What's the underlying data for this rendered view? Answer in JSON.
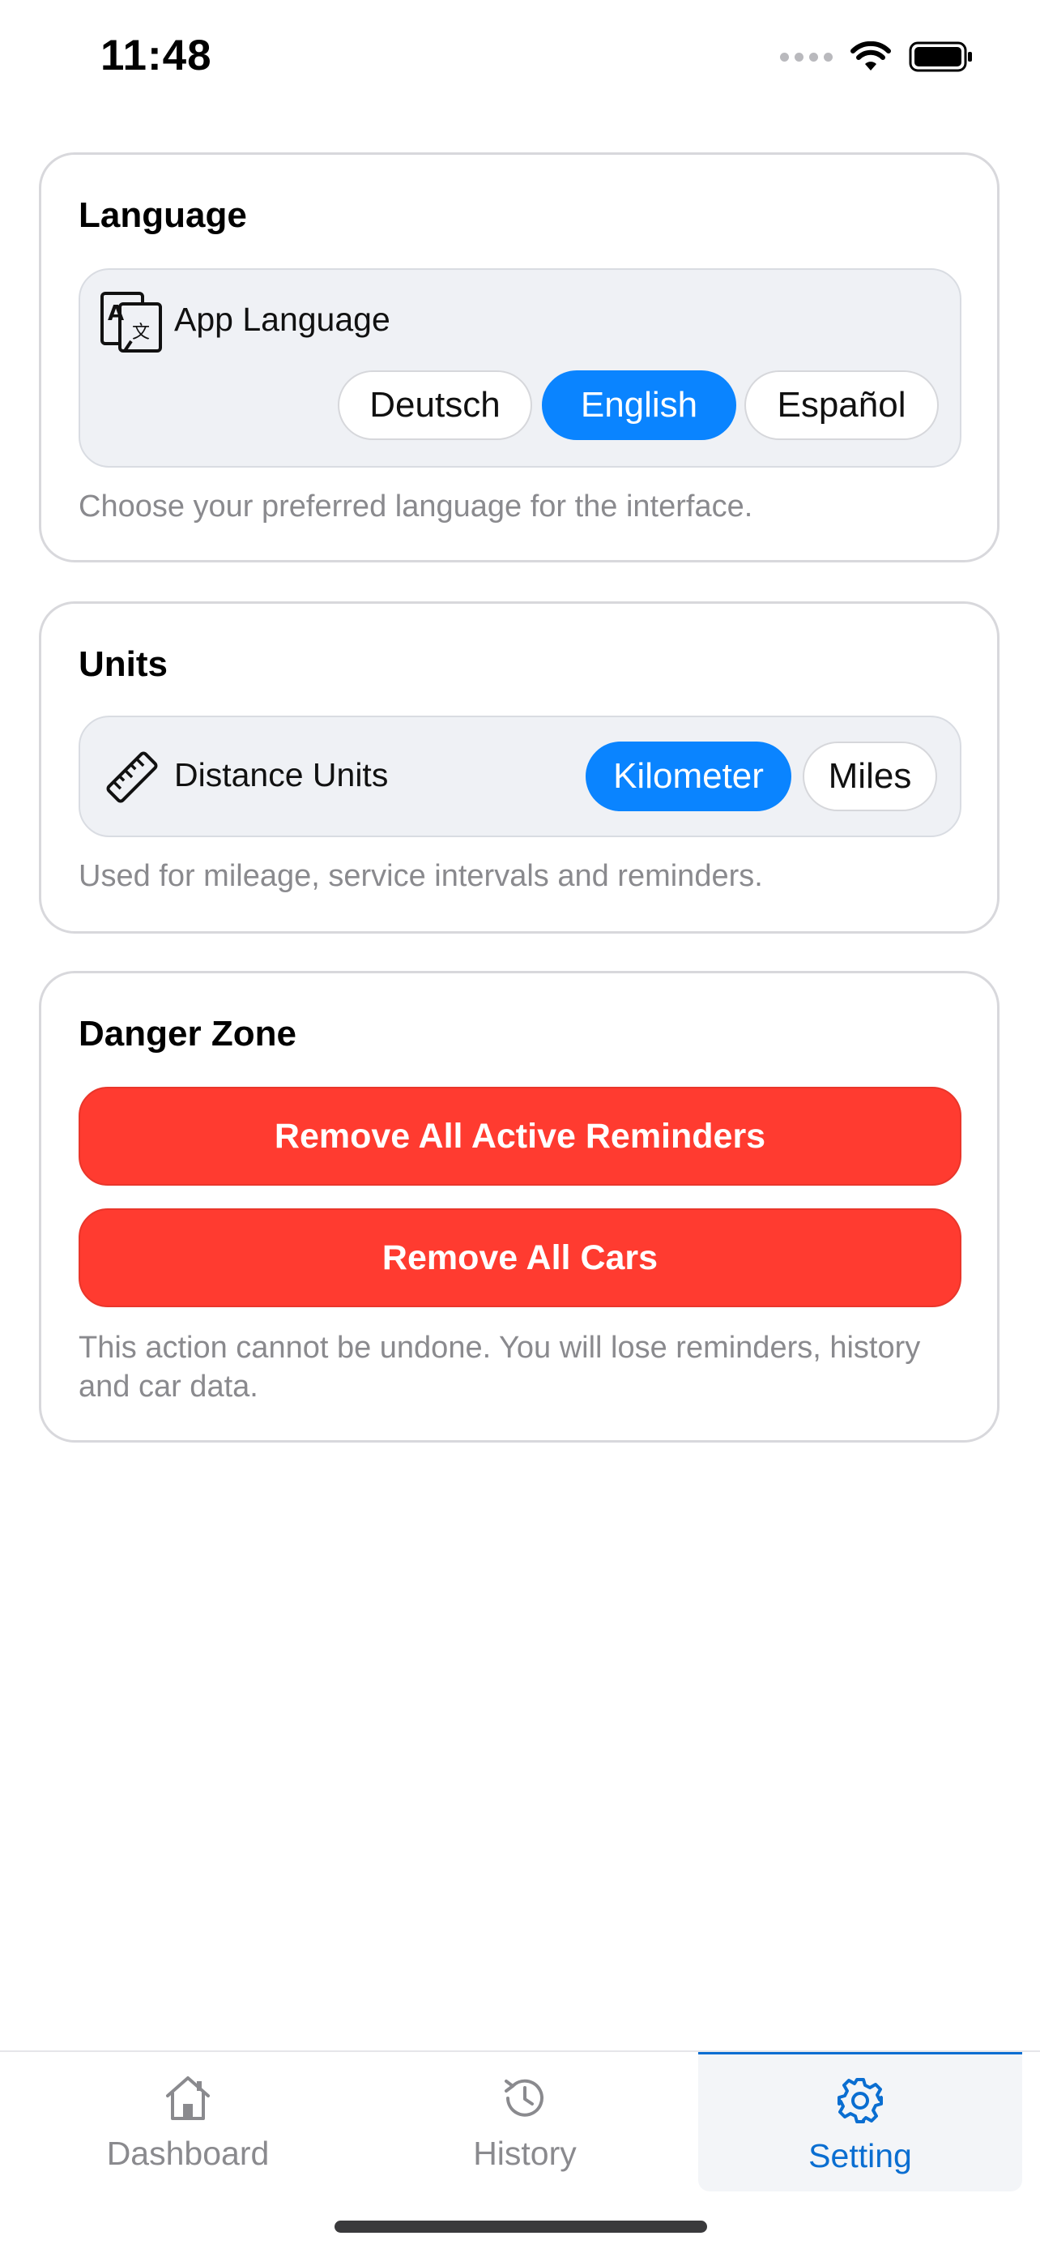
{
  "status_bar": {
    "time": "11:48"
  },
  "language_section": {
    "title": "Language",
    "row_label": "App Language",
    "row_icon": "translate-icon",
    "options": [
      "Deutsch",
      "English",
      "Español"
    ],
    "selected": "English",
    "helper": "Choose your preferred language for the interface."
  },
  "units_section": {
    "title": "Units",
    "row_label": "Distance Units",
    "row_icon": "ruler-icon",
    "options": [
      "Kilometer",
      "Miles"
    ],
    "selected": "Kilometer",
    "helper": "Used for mileage, service intervals and reminders."
  },
  "danger_section": {
    "title": "Danger Zone",
    "remove_reminders_label": "Remove All Active Reminders",
    "remove_cars_label": "Remove All Cars",
    "helper": "This action cannot be undone. You will lose reminders, history and car data."
  },
  "tab_bar": {
    "tabs": [
      {
        "label": "Dashboard",
        "icon": "home-icon"
      },
      {
        "label": "History",
        "icon": "history-icon"
      },
      {
        "label": "Setting",
        "icon": "gear-icon"
      }
    ],
    "active": "Setting"
  },
  "colors": {
    "accent": "#0a84ff",
    "danger": "#ff3b30",
    "active_tab": "#0a6ed1",
    "muted_text": "#8a8a8e"
  }
}
